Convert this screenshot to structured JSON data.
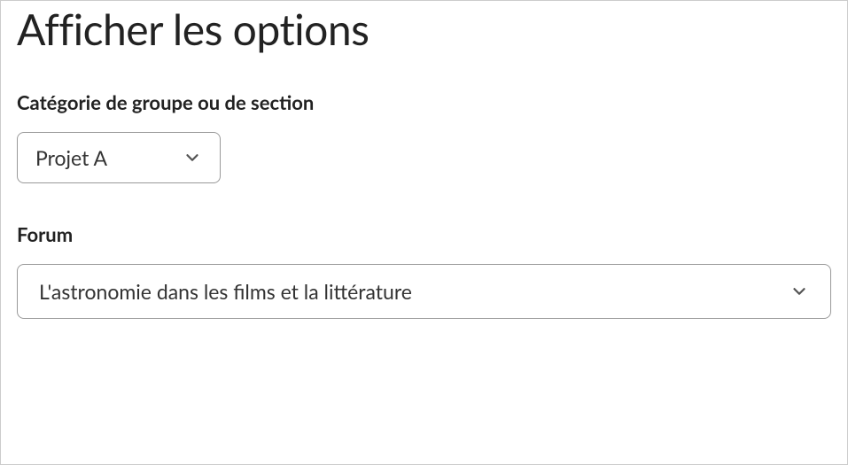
{
  "page_title": "Afficher les options",
  "fields": {
    "category": {
      "label": "Catégorie de groupe ou de section",
      "value": "Projet A"
    },
    "forum": {
      "label": "Forum",
      "value": "L'astronomie dans les films et la littérature"
    }
  }
}
